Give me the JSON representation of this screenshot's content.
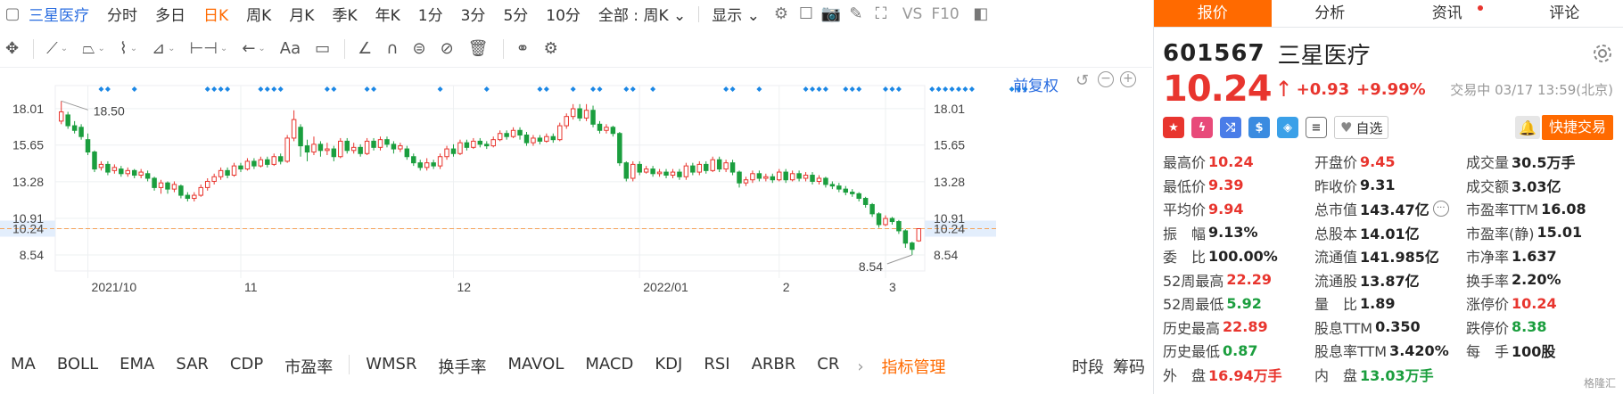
{
  "topbar": {
    "stock_name": "三星医疗",
    "periods": [
      "分时",
      "多日",
      "日K",
      "周K",
      "月K",
      "季K",
      "年K",
      "1分",
      "3分",
      "5分",
      "10分"
    ],
    "active_period": "日K",
    "range_select": "全部 : 周K",
    "display_label": "显示",
    "vs_label": "VS",
    "f10_label": "F10"
  },
  "toolbar": {
    "text_tool": "Aa"
  },
  "chart": {
    "fuquan_label": "前复权",
    "y_ticks": [
      "18.01",
      "15.65",
      "13.28",
      "10.91",
      "10.24",
      "8.54"
    ],
    "x_ticks": [
      "2021/10",
      "11",
      "12",
      "2022/01",
      "2",
      "3"
    ],
    "current_price_label": "10.24",
    "high_marker": "18.50",
    "low_marker": "8.54",
    "colors": {
      "up": "#e8352e",
      "down": "#1b9e3e",
      "dash": "#f5a35a",
      "marker": "#1b87e5"
    }
  },
  "chart_data": {
    "type": "candlestick",
    "title": "",
    "ylim": [
      7.5,
      19.5
    ],
    "y_ticks": [
      8.54,
      10.24,
      10.91,
      13.28,
      15.65,
      18.01
    ],
    "candles": [
      {
        "o": 17.2,
        "c": 17.8,
        "h": 18.5,
        "l": 17.0
      },
      {
        "o": 17.6,
        "c": 16.9,
        "h": 17.8,
        "l": 16.7
      },
      {
        "o": 16.9,
        "c": 16.6,
        "h": 17.2,
        "l": 16.4
      },
      {
        "o": 16.8,
        "c": 16.2,
        "h": 17.0,
        "l": 16.0
      },
      {
        "o": 16.0,
        "c": 15.2,
        "h": 16.4,
        "l": 15.0
      },
      {
        "o": 15.2,
        "c": 14.1,
        "h": 15.3,
        "l": 13.9
      },
      {
        "o": 14.2,
        "c": 14.4,
        "h": 14.6,
        "l": 14.0
      },
      {
        "o": 14.4,
        "c": 13.9,
        "h": 14.6,
        "l": 13.7
      },
      {
        "o": 14.0,
        "c": 14.2,
        "h": 14.4,
        "l": 13.8
      },
      {
        "o": 14.1,
        "c": 13.8,
        "h": 14.3,
        "l": 13.6
      },
      {
        "o": 13.8,
        "c": 14.0,
        "h": 14.2,
        "l": 13.6
      },
      {
        "o": 14.0,
        "c": 13.7,
        "h": 14.1,
        "l": 13.5
      },
      {
        "o": 13.7,
        "c": 13.9,
        "h": 14.1,
        "l": 13.5
      },
      {
        "o": 13.8,
        "c": 13.5,
        "h": 14.0,
        "l": 13.3
      },
      {
        "o": 13.5,
        "c": 12.9,
        "h": 13.6,
        "l": 12.7
      },
      {
        "o": 12.9,
        "c": 13.2,
        "h": 13.4,
        "l": 12.5
      },
      {
        "o": 13.2,
        "c": 12.8,
        "h": 13.3,
        "l": 12.5
      },
      {
        "o": 12.8,
        "c": 13.1,
        "h": 13.3,
        "l": 12.6
      },
      {
        "o": 13.0,
        "c": 12.4,
        "h": 13.1,
        "l": 12.2
      },
      {
        "o": 12.4,
        "c": 12.2,
        "h": 12.6,
        "l": 12.0
      },
      {
        "o": 12.2,
        "c": 12.4,
        "h": 12.6,
        "l": 12.0
      },
      {
        "o": 12.4,
        "c": 12.9,
        "h": 13.1,
        "l": 12.3
      },
      {
        "o": 12.9,
        "c": 13.3,
        "h": 13.5,
        "l": 12.7
      },
      {
        "o": 13.3,
        "c": 13.6,
        "h": 13.8,
        "l": 13.1
      },
      {
        "o": 13.6,
        "c": 14.0,
        "h": 14.2,
        "l": 13.4
      },
      {
        "o": 14.0,
        "c": 13.7,
        "h": 14.2,
        "l": 13.5
      },
      {
        "o": 13.7,
        "c": 14.3,
        "h": 14.5,
        "l": 13.6
      },
      {
        "o": 14.3,
        "c": 14.1,
        "h": 14.5,
        "l": 13.9
      },
      {
        "o": 14.1,
        "c": 14.6,
        "h": 14.8,
        "l": 14.0
      },
      {
        "o": 14.6,
        "c": 14.3,
        "h": 14.8,
        "l": 14.1
      },
      {
        "o": 14.3,
        "c": 14.7,
        "h": 14.9,
        "l": 14.2
      },
      {
        "o": 14.7,
        "c": 14.4,
        "h": 14.9,
        "l": 14.2
      },
      {
        "o": 14.4,
        "c": 14.9,
        "h": 15.1,
        "l": 14.3
      },
      {
        "o": 14.9,
        "c": 14.6,
        "h": 15.1,
        "l": 14.4
      },
      {
        "o": 14.6,
        "c": 16.1,
        "h": 16.3,
        "l": 14.5
      },
      {
        "o": 16.1,
        "c": 17.3,
        "h": 17.9,
        "l": 15.9
      },
      {
        "o": 16.8,
        "c": 15.6,
        "h": 17.0,
        "l": 14.9
      },
      {
        "o": 15.6,
        "c": 15.2,
        "h": 16.0,
        "l": 14.6
      },
      {
        "o": 15.2,
        "c": 15.7,
        "h": 16.2,
        "l": 15.0
      },
      {
        "o": 15.7,
        "c": 15.3,
        "h": 15.9,
        "l": 14.9
      },
      {
        "o": 15.3,
        "c": 15.4,
        "h": 15.8,
        "l": 15.0
      },
      {
        "o": 15.4,
        "c": 14.9,
        "h": 15.6,
        "l": 14.6
      },
      {
        "o": 14.9,
        "c": 15.9,
        "h": 16.1,
        "l": 14.8
      },
      {
        "o": 15.9,
        "c": 15.3,
        "h": 16.1,
        "l": 15.1
      },
      {
        "o": 15.3,
        "c": 15.5,
        "h": 15.8,
        "l": 15.1
      },
      {
        "o": 15.5,
        "c": 15.1,
        "h": 15.7,
        "l": 14.9
      },
      {
        "o": 15.1,
        "c": 15.9,
        "h": 16.1,
        "l": 15.0
      },
      {
        "o": 15.9,
        "c": 15.5,
        "h": 16.1,
        "l": 15.3
      },
      {
        "o": 15.5,
        "c": 16.0,
        "h": 16.2,
        "l": 15.3
      },
      {
        "o": 16.0,
        "c": 15.7,
        "h": 16.2,
        "l": 15.5
      },
      {
        "o": 15.7,
        "c": 15.4,
        "h": 15.9,
        "l": 15.1
      },
      {
        "o": 15.4,
        "c": 15.6,
        "h": 15.8,
        "l": 15.2
      },
      {
        "o": 15.4,
        "c": 14.9,
        "h": 15.6,
        "l": 14.7
      },
      {
        "o": 14.9,
        "c": 14.5,
        "h": 15.1,
        "l": 14.3
      },
      {
        "o": 14.5,
        "c": 14.2,
        "h": 14.7,
        "l": 14.0
      },
      {
        "o": 14.2,
        "c": 14.5,
        "h": 14.8,
        "l": 14.0
      },
      {
        "o": 14.5,
        "c": 14.3,
        "h": 14.7,
        "l": 14.1
      },
      {
        "o": 14.3,
        "c": 14.9,
        "h": 15.1,
        "l": 14.1
      },
      {
        "o": 14.9,
        "c": 15.4,
        "h": 15.6,
        "l": 14.7
      },
      {
        "o": 15.4,
        "c": 15.1,
        "h": 15.7,
        "l": 14.9
      },
      {
        "o": 15.1,
        "c": 15.8,
        "h": 16.0,
        "l": 15.0
      },
      {
        "o": 15.8,
        "c": 15.5,
        "h": 16.0,
        "l": 15.3
      },
      {
        "o": 15.5,
        "c": 15.9,
        "h": 16.1,
        "l": 15.4
      },
      {
        "o": 15.9,
        "c": 15.7,
        "h": 16.1,
        "l": 15.5
      },
      {
        "o": 15.7,
        "c": 15.6,
        "h": 15.9,
        "l": 15.4
      },
      {
        "o": 15.6,
        "c": 16.0,
        "h": 16.2,
        "l": 15.5
      },
      {
        "o": 16.0,
        "c": 16.4,
        "h": 16.6,
        "l": 15.9
      },
      {
        "o": 16.4,
        "c": 16.2,
        "h": 16.6,
        "l": 16.0
      },
      {
        "o": 16.2,
        "c": 16.6,
        "h": 16.8,
        "l": 16.1
      },
      {
        "o": 16.6,
        "c": 16.3,
        "h": 16.8,
        "l": 16.0
      },
      {
        "o": 16.3,
        "c": 15.8,
        "h": 16.5,
        "l": 15.6
      },
      {
        "o": 15.8,
        "c": 16.1,
        "h": 16.3,
        "l": 15.6
      },
      {
        "o": 16.1,
        "c": 15.9,
        "h": 16.3,
        "l": 15.7
      },
      {
        "o": 15.9,
        "c": 16.2,
        "h": 16.4,
        "l": 15.8
      },
      {
        "o": 16.2,
        "c": 16.0,
        "h": 16.4,
        "l": 15.8
      },
      {
        "o": 16.0,
        "c": 16.9,
        "h": 17.1,
        "l": 15.9
      },
      {
        "o": 16.9,
        "c": 17.5,
        "h": 17.7,
        "l": 16.7
      },
      {
        "o": 17.5,
        "c": 18.0,
        "h": 18.3,
        "l": 17.3
      },
      {
        "o": 18.0,
        "c": 17.4,
        "h": 18.3,
        "l": 17.2
      },
      {
        "o": 17.4,
        "c": 17.9,
        "h": 18.3,
        "l": 17.2
      },
      {
        "o": 17.9,
        "c": 17.0,
        "h": 18.2,
        "l": 16.8
      },
      {
        "o": 17.0,
        "c": 16.6,
        "h": 17.2,
        "l": 16.4
      },
      {
        "o": 16.6,
        "c": 16.8,
        "h": 17.0,
        "l": 16.4
      },
      {
        "o": 16.8,
        "c": 16.4,
        "h": 16.9,
        "l": 16.2
      },
      {
        "o": 16.4,
        "c": 14.5,
        "h": 16.5,
        "l": 14.3
      },
      {
        "o": 14.5,
        "c": 13.5,
        "h": 14.6,
        "l": 13.3
      },
      {
        "o": 13.5,
        "c": 14.4,
        "h": 14.6,
        "l": 13.3
      },
      {
        "o": 14.4,
        "c": 13.9,
        "h": 14.6,
        "l": 13.7
      },
      {
        "o": 13.9,
        "c": 14.1,
        "h": 14.3,
        "l": 13.8
      },
      {
        "o": 14.1,
        "c": 13.8,
        "h": 14.3,
        "l": 13.6
      },
      {
        "o": 13.8,
        "c": 13.9,
        "h": 14.1,
        "l": 13.6
      },
      {
        "o": 13.9,
        "c": 13.7,
        "h": 14.1,
        "l": 13.5
      },
      {
        "o": 13.7,
        "c": 13.9,
        "h": 14.1,
        "l": 13.5
      },
      {
        "o": 13.9,
        "c": 13.6,
        "h": 14.1,
        "l": 13.4
      },
      {
        "o": 13.6,
        "c": 14.3,
        "h": 14.5,
        "l": 13.4
      },
      {
        "o": 14.3,
        "c": 13.9,
        "h": 14.5,
        "l": 13.7
      },
      {
        "o": 13.9,
        "c": 14.4,
        "h": 14.6,
        "l": 13.7
      },
      {
        "o": 14.4,
        "c": 14.0,
        "h": 14.6,
        "l": 13.8
      },
      {
        "o": 14.0,
        "c": 14.7,
        "h": 14.9,
        "l": 13.9
      },
      {
        "o": 14.7,
        "c": 14.1,
        "h": 14.9,
        "l": 13.9
      },
      {
        "o": 14.1,
        "c": 14.5,
        "h": 14.7,
        "l": 13.9
      },
      {
        "o": 14.5,
        "c": 13.9,
        "h": 14.7,
        "l": 13.7
      },
      {
        "o": 13.9,
        "c": 13.2,
        "h": 14.0,
        "l": 12.9
      },
      {
        "o": 13.2,
        "c": 13.4,
        "h": 13.6,
        "l": 13.0
      },
      {
        "o": 13.4,
        "c": 13.8,
        "h": 14.0,
        "l": 13.2
      },
      {
        "o": 13.8,
        "c": 13.5,
        "h": 14.0,
        "l": 13.3
      },
      {
        "o": 13.5,
        "c": 13.6,
        "h": 13.8,
        "l": 13.3
      },
      {
        "o": 13.6,
        "c": 13.4,
        "h": 13.8,
        "l": 13.2
      },
      {
        "o": 13.4,
        "c": 13.9,
        "h": 14.1,
        "l": 13.3
      },
      {
        "o": 13.9,
        "c": 13.4,
        "h": 14.1,
        "l": 13.2
      },
      {
        "o": 13.4,
        "c": 13.8,
        "h": 14.0,
        "l": 13.3
      },
      {
        "o": 13.8,
        "c": 13.5,
        "h": 14.0,
        "l": 13.3
      },
      {
        "o": 13.5,
        "c": 13.7,
        "h": 13.9,
        "l": 13.3
      },
      {
        "o": 13.7,
        "c": 13.3,
        "h": 13.9,
        "l": 13.1
      },
      {
        "o": 13.3,
        "c": 13.5,
        "h": 13.7,
        "l": 13.1
      },
      {
        "o": 13.5,
        "c": 13.1,
        "h": 13.6,
        "l": 12.9
      },
      {
        "o": 13.1,
        "c": 13.0,
        "h": 13.3,
        "l": 12.8
      },
      {
        "o": 13.0,
        "c": 12.8,
        "h": 13.2,
        "l": 12.6
      },
      {
        "o": 12.8,
        "c": 12.6,
        "h": 13.0,
        "l": 12.4
      },
      {
        "o": 12.6,
        "c": 12.5,
        "h": 12.8,
        "l": 12.3
      },
      {
        "o": 12.5,
        "c": 12.2,
        "h": 12.6,
        "l": 12.0
      },
      {
        "o": 12.2,
        "c": 11.8,
        "h": 12.3,
        "l": 11.6
      },
      {
        "o": 11.8,
        "c": 11.2,
        "h": 11.9,
        "l": 11.0
      },
      {
        "o": 11.2,
        "c": 10.5,
        "h": 11.3,
        "l": 10.3
      },
      {
        "o": 10.5,
        "c": 10.9,
        "h": 11.1,
        "l": 10.4
      },
      {
        "o": 10.9,
        "c": 10.7,
        "h": 11.0,
        "l": 10.5
      },
      {
        "o": 10.7,
        "c": 10.1,
        "h": 10.8,
        "l": 9.9
      },
      {
        "o": 10.1,
        "c": 9.3,
        "h": 10.2,
        "l": 9.0
      },
      {
        "o": 9.31,
        "c": 8.9,
        "h": 9.4,
        "l": 8.54
      },
      {
        "o": 9.45,
        "c": 10.24,
        "h": 10.24,
        "l": 9.39
      }
    ],
    "markers": [
      6,
      7,
      11,
      22,
      23,
      24,
      25,
      30,
      31,
      32,
      33,
      40,
      41,
      46,
      47,
      57,
      64,
      72,
      73,
      77,
      80,
      81,
      85,
      86,
      89,
      100,
      101,
      105,
      112,
      113,
      114,
      115,
      118,
      119,
      120,
      124,
      125,
      126,
      131,
      132,
      133,
      134,
      135,
      136,
      137,
      143,
      144,
      145
    ]
  },
  "indicators": {
    "items": [
      "MA",
      "BOLL",
      "EMA",
      "SAR",
      "CDP",
      "市盈率",
      "WMSR",
      "换手率",
      "MAVOL",
      "MACD",
      "KDJ",
      "RSI",
      "ARBR",
      "CR"
    ],
    "manage": "指标管理",
    "right": [
      "时段",
      "筹码"
    ]
  },
  "panel": {
    "tabs": [
      "报价",
      "分析",
      "资讯",
      "评论"
    ],
    "active_tab": "报价",
    "code": "601567",
    "name": "三星医疗",
    "price": "10.24",
    "change": "+0.93",
    "pct": "+9.99%",
    "status": "交易中 03/17 13:59(北京)",
    "watch": "自选",
    "fast_trade": "快捷交易",
    "rows": [
      [
        [
          "最高价",
          "10.24",
          "red"
        ],
        [
          "开盘价",
          "9.45",
          "red"
        ],
        [
          "成交量",
          "30.5万手",
          ""
        ]
      ],
      [
        [
          "最低价",
          "9.39",
          "red"
        ],
        [
          "昨收价",
          "9.31",
          ""
        ],
        [
          "成交额",
          "3.03亿",
          ""
        ]
      ],
      [
        [
          "平均价",
          "9.94",
          "red"
        ],
        [
          "总市值",
          "143.47亿",
          ""
        ],
        [
          "市盈率TTM",
          "16.08",
          ""
        ]
      ],
      [
        [
          "振　幅",
          "9.13%",
          ""
        ],
        [
          "总股本",
          "14.01亿",
          ""
        ],
        [
          "市盈率(静)",
          "15.01",
          ""
        ]
      ],
      [
        [
          "委　比",
          "100.00%",
          ""
        ],
        [
          "流通值",
          "141.985亿",
          ""
        ],
        [
          "市净率",
          "1.637",
          ""
        ]
      ],
      [
        [
          "52周最高",
          "22.29",
          "red"
        ],
        [
          "流通股",
          "13.87亿",
          ""
        ],
        [
          "换手率",
          "2.20%",
          ""
        ]
      ],
      [
        [
          "52周最低",
          "5.92",
          "green"
        ],
        [
          "量　比",
          "1.89",
          ""
        ],
        [
          "涨停价",
          "10.24",
          "red"
        ]
      ],
      [
        [
          "历史最高",
          "22.89",
          "red"
        ],
        [
          "股息TTM",
          "0.350",
          ""
        ],
        [
          "跌停价",
          "8.38",
          "green"
        ]
      ],
      [
        [
          "历史最低",
          "0.87",
          "green"
        ],
        [
          "股息率TTM",
          "3.420%",
          ""
        ],
        [
          "每　手",
          "100股",
          ""
        ]
      ],
      [
        [
          "外　盘",
          "16.94万手",
          "red"
        ],
        [
          "内　盘",
          "13.03万手",
          "green"
        ],
        [
          "",
          "",
          " "
        ]
      ]
    ],
    "watermark": "格隆汇"
  }
}
